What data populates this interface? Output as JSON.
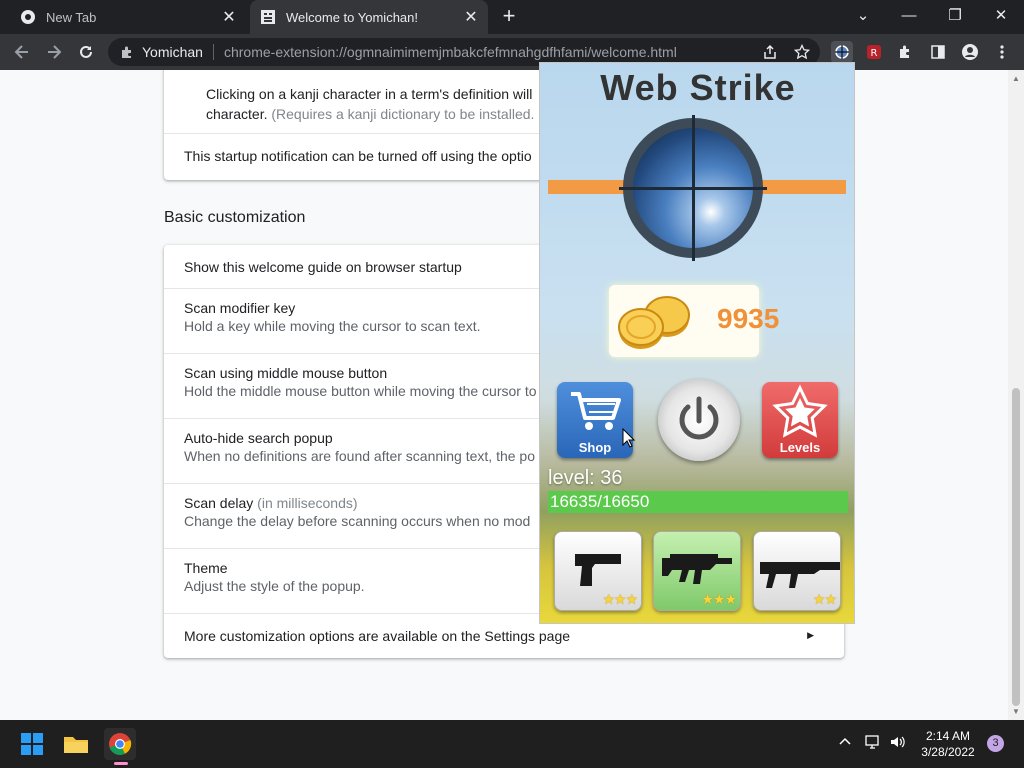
{
  "browser": {
    "tabs": [
      {
        "title": "New Tab",
        "close": "✕"
      },
      {
        "title": "Welcome to Yomichan!",
        "close": "✕"
      }
    ],
    "new_tab": "+",
    "window_controls": {
      "minimize": "—",
      "restore": "❐",
      "close": "✕",
      "tab_search": "⌄"
    },
    "omnibox": {
      "site_name": "Yomichan",
      "url": "chrome-extension://ogmnaimimemjmbakcfefmnahgdfhfami/welcome.html"
    },
    "icons": [
      "back-icon",
      "forward-icon",
      "reload-icon",
      "extension-icon",
      "share-icon",
      "bookmark-star-icon",
      "yomichan-icon",
      "web-strike-icon",
      "puzzle-icon",
      "side-panel-icon",
      "profile-icon",
      "menu-icon"
    ]
  },
  "page": {
    "card1": {
      "line1": "Clicking on a kanji character in a term's definition will",
      "line2_main": "character.",
      "line2_muted": "(Requires a kanji dictionary to be installed.",
      "notice": "This startup notification can be turned off using the optio"
    },
    "section_heading": "Basic customization",
    "settings": [
      {
        "label": "Show this welcome guide on browser startup",
        "desc": ""
      },
      {
        "label": "Scan modifier key",
        "desc": "Hold a key while moving the cursor to scan text."
      },
      {
        "label": "Scan using middle mouse button",
        "desc": "Hold the middle mouse button while moving the cursor to"
      },
      {
        "label": "Auto-hide search popup",
        "desc": "When no definitions are found after scanning text, the po"
      },
      {
        "label": "Scan delay",
        "label_muted": "(in milliseconds)",
        "desc": "Change the delay before scanning occurs when no mod"
      },
      {
        "label": "Theme",
        "desc": "Adjust the style of the popup."
      }
    ],
    "more_options": "More customization options are available on the Settings page"
  },
  "popup": {
    "title": "Web Strike",
    "coins": "9935",
    "shop_label": "Shop",
    "levels_label": "Levels",
    "level_text": "level: 36",
    "xp_text": "16635/16650",
    "xp_fraction": 0.999,
    "weapons": [
      {
        "name": "pistol",
        "stars": "★★★"
      },
      {
        "name": "mp5",
        "stars": "★★★"
      },
      {
        "name": "rifle",
        "stars": "★★"
      }
    ]
  },
  "taskbar": {
    "time": "2:14 AM",
    "date": "3/28/2022",
    "notifications": "3",
    "icons": [
      "windows-start-icon",
      "file-explorer-icon",
      "chrome-icon",
      "chevron-up-icon",
      "network-icon",
      "volume-icon"
    ]
  }
}
